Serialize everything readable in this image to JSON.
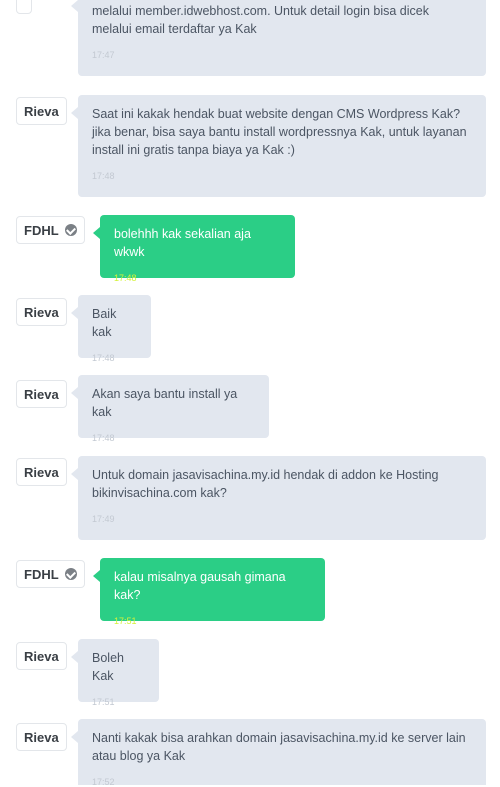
{
  "messages": [
    {
      "sender": "",
      "text": "melalui member.idwebhost.com. Untuk detail login bisa dicek melalui email terdaftar ya Kak",
      "time": "17:47"
    },
    {
      "sender": "Rieva",
      "text": "Saat ini kakak hendak buat website dengan CMS Wordpress Kak? jika benar, bisa saya bantu install wordpressnya Kak, untuk layanan install ini gratis tanpa biaya ya Kak :)",
      "time": "17:48"
    },
    {
      "sender": "FDHL",
      "text": "bolehhh kak sekalian aja wkwk",
      "time": "17:48"
    },
    {
      "sender": "Rieva",
      "text": "Baik kak",
      "time": "17:48"
    },
    {
      "sender": "Rieva",
      "text": "Akan saya bantu install ya kak",
      "time": "17:48"
    },
    {
      "sender": "Rieva",
      "text": "Untuk domain jasavisachina.my.id hendak di addon ke Hosting bikinvisachina.com kak?",
      "time": "17:49"
    },
    {
      "sender": "FDHL",
      "text": "kalau misalnya gausah gimana kak?",
      "time": "17:51"
    },
    {
      "sender": "Rieva",
      "text": "Boleh Kak",
      "time": "17:51"
    },
    {
      "sender": "Rieva",
      "text": "Nanti kakak bisa arahkan domain jasavisachina.my.id ke server lain atau blog ya Kak",
      "time": "17:52"
    }
  ],
  "icons": {
    "verified": "verified-check-icon"
  },
  "colors": {
    "incoming_bubble": "#e2e7ef",
    "outgoing_bubble": "#2bce86",
    "outgoing_time": "#d4f23a"
  }
}
